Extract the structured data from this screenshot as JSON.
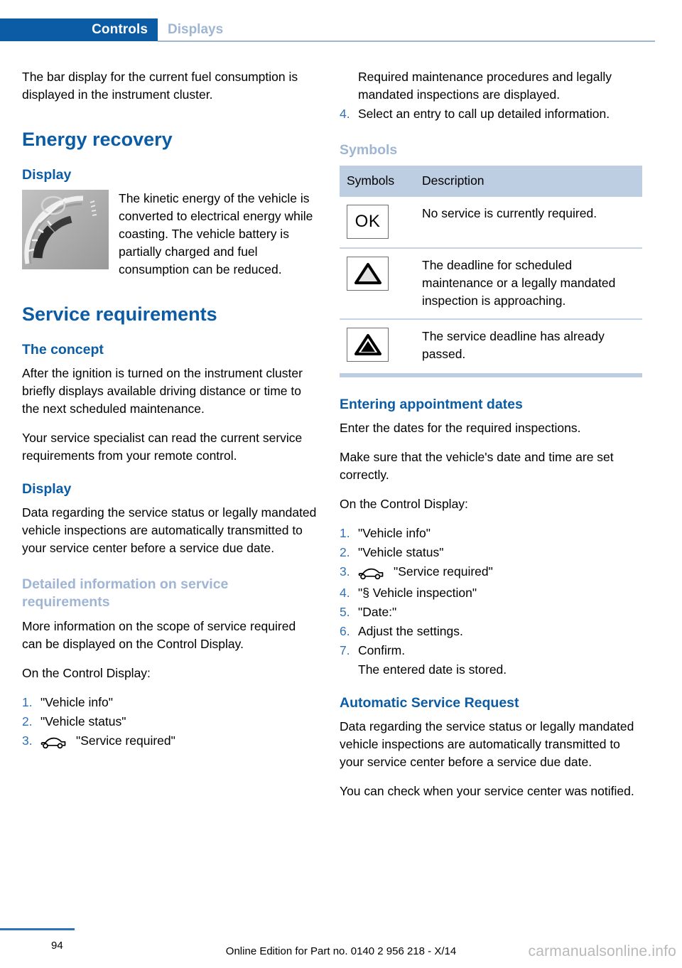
{
  "header": {
    "active_tab": "Controls",
    "inactive_tab": "Displays",
    "accent_blue": "#0b5ca4",
    "light_blue": "#9fb5d4"
  },
  "left_column": {
    "intro_paragraph": "The bar display for the current fuel consumption is displayed in the instrument cluster.",
    "energy_recovery_heading": "Energy recovery",
    "display_heading_1": "Display",
    "figure_caption": "The kinetic energy of the vehicle is converted to electrical energy while coasting. The vehicle battery is partially charged and fuel consumption can be reduced.",
    "service_requirements_heading": "Service requirements",
    "the_concept_heading": "The concept",
    "concept_paragraph_1": "After the ignition is turned on the instrument cluster briefly displays available driving distance or time to the next scheduled maintenance.",
    "concept_paragraph_2": "Your service specialist can read the current service requirements from your remote control.",
    "display_heading_2": "Display",
    "display_paragraph": "Data regarding the service status or legally mandated vehicle inspections are automatically transmitted to your service center before a service due date.",
    "detailed_info_heading": "Detailed information on service requirements",
    "detailed_info_paragraph": "More information on the scope of service required can be displayed on the Control Display.",
    "control_display_lead": "On the Control Display:",
    "steps": [
      {
        "num": "1.",
        "text": "\"Vehicle info\"",
        "icon": ""
      },
      {
        "num": "2.",
        "text": "\"Vehicle status\"",
        "icon": ""
      },
      {
        "num": "3.",
        "text": "\"Service required\"",
        "icon": "car-icon"
      }
    ]
  },
  "right_column": {
    "continued_step_note": "Required maintenance procedures and legally mandated inspections are displayed.",
    "step_4": {
      "num": "4.",
      "text": "Select an entry to call up detailed information."
    },
    "symbols_heading": "Symbols",
    "table": {
      "columns": [
        "Symbols",
        "Description"
      ],
      "rows": [
        {
          "symbol": "OK",
          "symbol_kind": "ok-text",
          "description": "No service is currently required."
        },
        {
          "symbol": "",
          "symbol_kind": "warning-triangle-outline",
          "description": "The deadline for scheduled maintenance or a legally mandated inspection is approaching."
        },
        {
          "symbol": "",
          "symbol_kind": "warning-triangle-filled",
          "description": "The service deadline has already passed."
        }
      ]
    },
    "entering_dates_heading": "Entering appointment dates",
    "entering_paragraph_1": "Enter the dates for the required inspections.",
    "entering_paragraph_2": "Make sure that the vehicle's date and time are set correctly.",
    "control_display_lead": "On the Control Display:",
    "steps": [
      {
        "num": "1.",
        "text": "\"Vehicle info\"",
        "icon": ""
      },
      {
        "num": "2.",
        "text": "\"Vehicle status\"",
        "icon": ""
      },
      {
        "num": "3.",
        "text": "\"Service required\"",
        "icon": "car-icon"
      },
      {
        "num": "4.",
        "text": "\"§ Vehicle inspection\"",
        "icon": ""
      },
      {
        "num": "5.",
        "text": "\"Date:\"",
        "icon": ""
      },
      {
        "num": "6.",
        "text": "Adjust the settings.",
        "icon": ""
      },
      {
        "num": "7.",
        "text": "Confirm.",
        "icon": ""
      }
    ],
    "steps_note": "The entered date is stored.",
    "automatic_request_heading": "Automatic Service Request",
    "automatic_paragraph_1": "Data regarding the service status or legally mandated vehicle inspections are automatically transmitted to your service center before a service due date.",
    "automatic_paragraph_2": "You can check when your service center was notified."
  },
  "footer": {
    "page_number": "94",
    "edition_line": "Online Edition for Part no. 0140 2 956 218 - X/14",
    "watermark": "carmanualsonline.info"
  }
}
